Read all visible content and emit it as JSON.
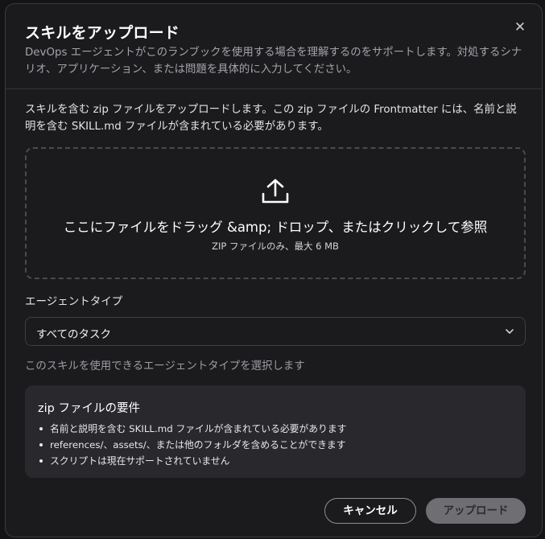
{
  "dialog": {
    "title": "スキルをアップロード",
    "subtitle": "DevOps エージェントがこのランブックを使用する場合を理解するのをサポートします。対処するシナリオ、アプリケーション、または問題を具体的に入力してください。",
    "close_icon": "close-icon"
  },
  "intro": "スキルを含む zip ファイルをアップロードします。この zip ファイルの Frontmatter には、名前と説明を含む SKILL.md ファイルが含まれている必要があります。",
  "dropzone": {
    "icon": "upload-icon",
    "main_text": "ここにファイルをドラッグ &amp; ドロップ、またはクリックして参照",
    "sub_text": "ZIP ファイルのみ、最大 6 MB"
  },
  "agent_type": {
    "label": "エージェントタイプ",
    "selected": "すべてのタスク",
    "helper": "このスキルを使用できるエージェントタイプを選択します"
  },
  "requirements": {
    "title": "zip ファイルの要件",
    "items": [
      "名前と説明を含む SKILL.md ファイルが含まれている必要があります",
      "references/、assets/、または他のフォルダを含めることができます",
      "スクリプトは現在サポートされていません"
    ]
  },
  "buttons": {
    "cancel": "キャンセル",
    "upload": "アップロード"
  },
  "colors": {
    "background": "#1b1b1e",
    "border": "#3a3a3f",
    "text": "#e8e8ea",
    "muted": "#a3a3aa",
    "disabled_button": "#6e6e73"
  }
}
